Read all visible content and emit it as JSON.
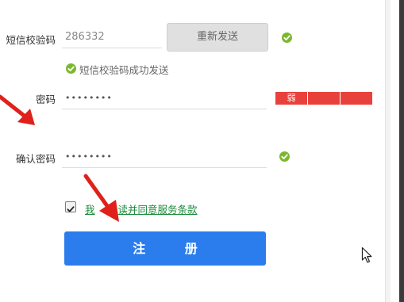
{
  "form": {
    "sms_code": {
      "label": "短信校验码",
      "value": "286332",
      "resend_label": "重新发送",
      "success_message": "短信校验码成功发送"
    },
    "password": {
      "label": "密码",
      "value": "••••••••",
      "strength_label": "弱",
      "strength_level": "weak"
    },
    "confirm_password": {
      "label": "确认密码",
      "value": "••••••••"
    },
    "agreement": {
      "checked": true,
      "visible_text_left": "我",
      "visible_text_right": "读并同意服务条款"
    },
    "register_label": "注 册"
  },
  "colors": {
    "accent_blue": "#2b7ded",
    "success_green": "#7cb82f",
    "strength_red": "#e8413b",
    "arrow_red": "#e0201a"
  },
  "icons": {
    "valid": "check-circle-icon",
    "annotation": "red-arrow-icon",
    "pointer": "mouse-cursor-icon"
  }
}
